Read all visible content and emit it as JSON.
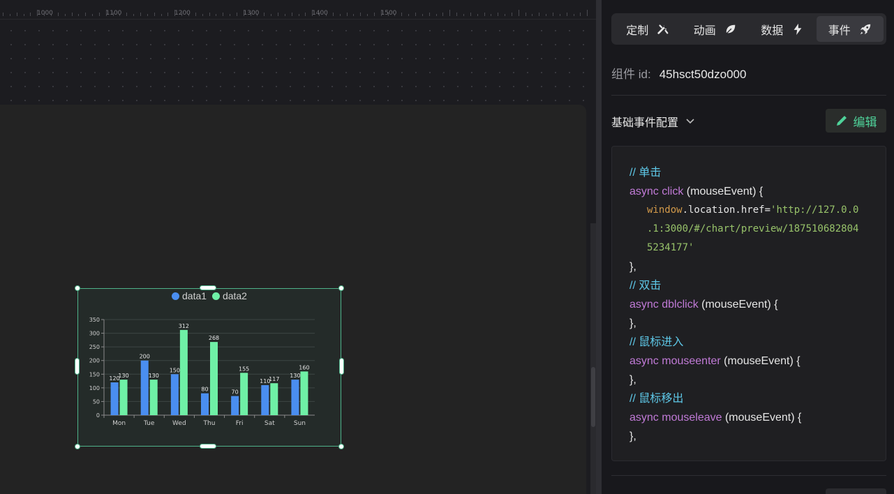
{
  "ruler": {
    "labels": [
      "1000",
      "1100",
      "1200",
      "1300",
      "1400",
      "1500"
    ]
  },
  "chart_component": {
    "legend": [
      {
        "name": "data1",
        "color": "#4a8ef0"
      },
      {
        "name": "data2",
        "color": "#6ff0a6"
      }
    ]
  },
  "chart_data": {
    "type": "bar",
    "categories": [
      "Mon",
      "Tue",
      "Wed",
      "Thu",
      "Fri",
      "Sat",
      "Sun"
    ],
    "series": [
      {
        "name": "data1",
        "values": [
          120,
          200,
          150,
          80,
          70,
          110,
          130
        ],
        "color": "#4a8ef0"
      },
      {
        "name": "data2",
        "values": [
          130,
          130,
          312,
          268,
          155,
          117,
          160
        ],
        "color": "#6ff0a6"
      }
    ],
    "yticks": [
      "0",
      "50",
      "100",
      "150",
      "200",
      "250",
      "300",
      "350"
    ],
    "ylim": [
      0,
      350
    ],
    "legend_position": "top-center",
    "grid": true
  },
  "side_panel": {
    "tabs": [
      {
        "label": "定制",
        "icon": "tools-icon",
        "active": false
      },
      {
        "label": "动画",
        "icon": "leaf-icon",
        "active": false
      },
      {
        "label": "数据",
        "icon": "lightning-icon",
        "active": false
      },
      {
        "label": "事件",
        "icon": "rocket-icon",
        "active": true
      }
    ],
    "component_id_label": "组件 id:",
    "component_id_value": "45hsct50dzo000",
    "section_title": "基础事件配置",
    "edit_label": "编辑"
  },
  "code": {
    "click_comment": "// 单击",
    "click_kw": "async click",
    "click_arg": " (mouseEvent) {",
    "click_body_obj": "window",
    "click_body_prop": ".location.href=",
    "click_body_str1": "'http://127.0.0",
    "click_body_str2": ".1:3000/#/chart/preview/187510682804",
    "click_body_str3": "5234177'",
    "close1": "},",
    "dbl_comment": "// 双击",
    "dbl_kw": "async dblclick",
    "dbl_arg": " (mouseEvent) {",
    "close2": "},",
    "enter_comment": "// 鼠标进入",
    "enter_kw": "async mouseenter",
    "enter_arg": " (mouseEvent) {",
    "close3": "},",
    "leave_comment": "// 鼠标移出",
    "leave_kw": "async mouseleave",
    "leave_arg": " (mouseEvent) {",
    "close4": "},"
  }
}
